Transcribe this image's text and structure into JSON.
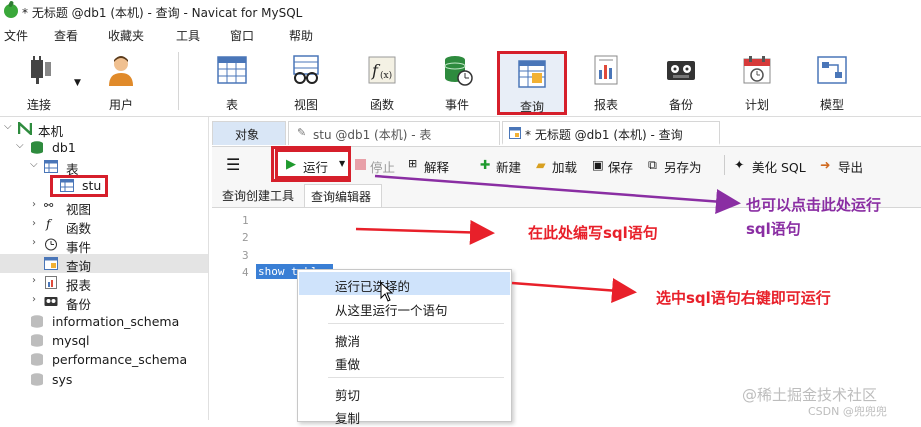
{
  "window": {
    "title": "* 无标题 @db1 (本机) - 查询 - Navicat for MySQL"
  },
  "menubar": [
    "文件",
    "查看",
    "收藏夹",
    "工具",
    "窗口",
    "帮助"
  ],
  "toolbar": {
    "buttons": [
      {
        "label": "连接",
        "icon": "plug-icon"
      },
      {
        "label": "用户",
        "icon": "user-icon"
      },
      {
        "label": "表",
        "icon": "table-icon"
      },
      {
        "label": "视图",
        "icon": "glasses-icon"
      },
      {
        "label": "函数",
        "icon": "function-icon"
      },
      {
        "label": "事件",
        "icon": "event-icon"
      },
      {
        "label": "查询",
        "icon": "query-icon"
      },
      {
        "label": "报表",
        "icon": "report-icon"
      },
      {
        "label": "备份",
        "icon": "backup-icon"
      },
      {
        "label": "计划",
        "icon": "calendar-icon"
      },
      {
        "label": "模型",
        "icon": "model-icon"
      }
    ],
    "active": "查询"
  },
  "sidebar": {
    "items": [
      {
        "label": "本机"
      },
      {
        "label": "db1"
      },
      {
        "label": "表"
      },
      {
        "label": "stu"
      },
      {
        "label": "视图"
      },
      {
        "label": "函数"
      },
      {
        "label": "事件"
      },
      {
        "label": "查询"
      },
      {
        "label": "报表"
      },
      {
        "label": "备份"
      },
      {
        "label": "information_schema"
      },
      {
        "label": "mysql"
      },
      {
        "label": "performance_schema"
      },
      {
        "label": "sys"
      }
    ]
  },
  "tabs": [
    {
      "label": "对象"
    },
    {
      "label": "stu @db1 (本机) - 表"
    },
    {
      "label": "* 无标题 @db1 (本机) - 查询"
    }
  ],
  "query_toolbar": {
    "menu_glyph": "☰",
    "run": "运行",
    "stop": "停止",
    "explain": "解释",
    "new": "新建",
    "load": "加载",
    "save": "保存",
    "save_as": "另存为",
    "beautify": "美化 SQL",
    "export": "导出"
  },
  "subtabs": [
    "查询创建工具",
    "查询编辑器"
  ],
  "editor": {
    "line_numbers": [
      "1",
      "2",
      "3",
      "4"
    ],
    "code_line4": "show tables"
  },
  "context_menu": {
    "items": [
      "运行已选择的",
      "从这里运行一个语句",
      "撤消",
      "重做",
      "剪切",
      "复制"
    ]
  },
  "annotations": {
    "editor_note": "在此处编写sql语句",
    "run_note_line1": "也可以点击此处运行",
    "run_note_line2": "sql语句",
    "ctx_note": "选中sql语句右键即可运行"
  },
  "watermark": {
    "line1": "@稀土掘金技术社区",
    "line2": "CSDN @兜兜兜"
  },
  "colors": {
    "annotation_red": "#e8202a",
    "annotation_purple": "#8a2ea3",
    "selection_blue": "#3a7fd5",
    "run_green": "#1f9a2e"
  }
}
